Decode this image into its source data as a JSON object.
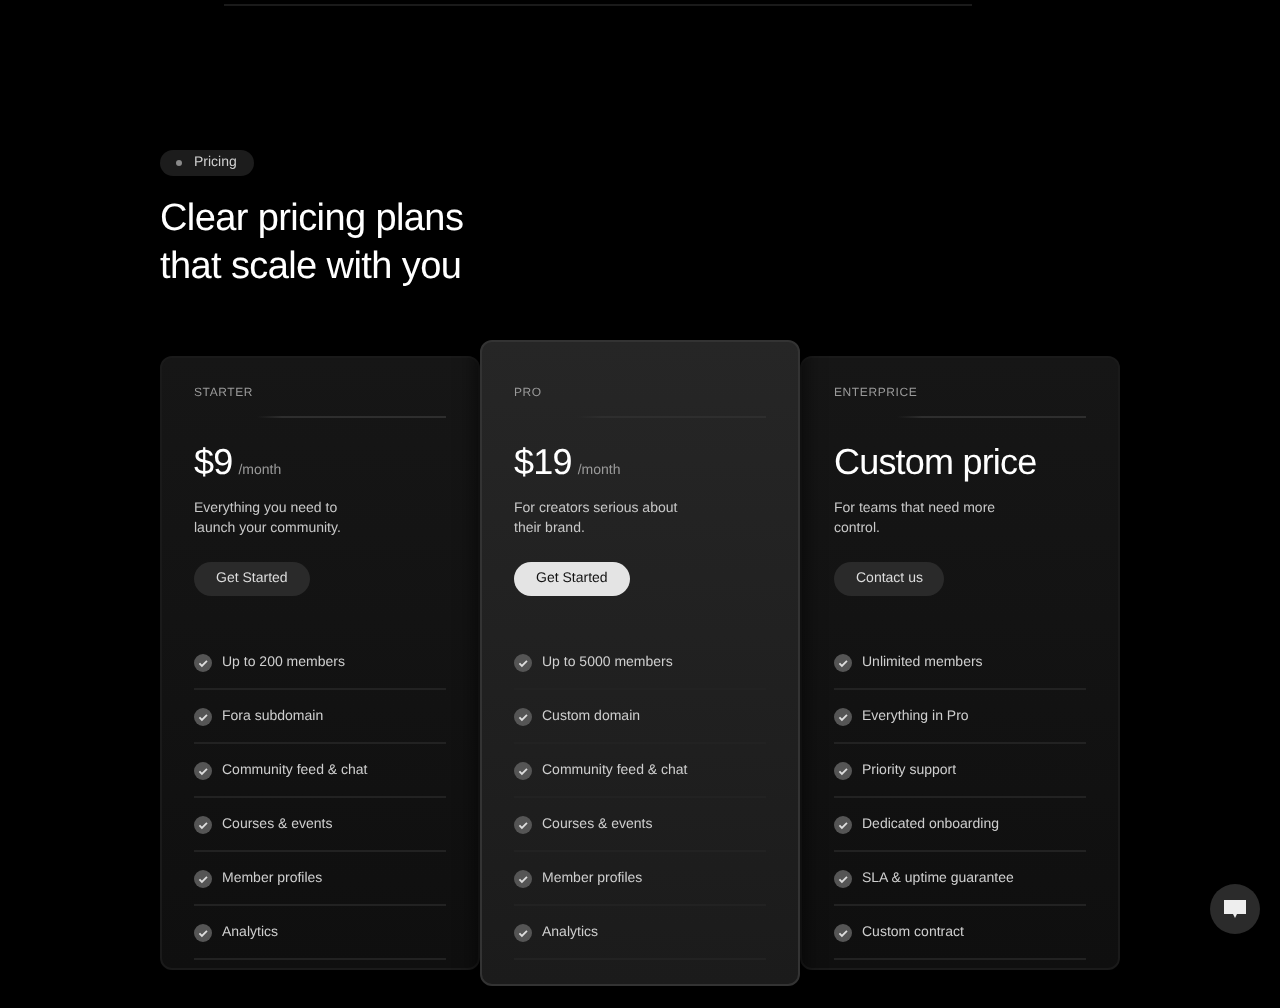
{
  "badge": "Pricing",
  "title": "Clear pricing plans that scale with you",
  "plans": [
    {
      "name": "STARTER",
      "highlighted": false,
      "price": "$9",
      "period": "/month",
      "description": "Everything you need to launch your community.",
      "button": "Get Started",
      "features": [
        "Up to 200 members",
        "Fora subdomain",
        "Community feed & chat",
        "Courses & events",
        "Member profiles",
        "Analytics"
      ]
    },
    {
      "name": "PRO",
      "highlighted": true,
      "price": "$19",
      "period": "/month",
      "description": "For creators serious about their brand.",
      "button": "Get Started",
      "features": [
        "Up to 5000 members",
        "Custom domain",
        "Community feed & chat",
        "Courses & events",
        "Member profiles",
        "Analytics"
      ]
    },
    {
      "name": "ENTERPRICE",
      "highlighted": false,
      "price": "Custom price",
      "description": "For teams that need more control.",
      "button": "Contact us",
      "features": [
        "Unlimited members",
        "Everything in Pro",
        "Priority support",
        "Dedicated onboarding",
        "SLA & uptime guarantee",
        "Custom contract"
      ]
    }
  ]
}
